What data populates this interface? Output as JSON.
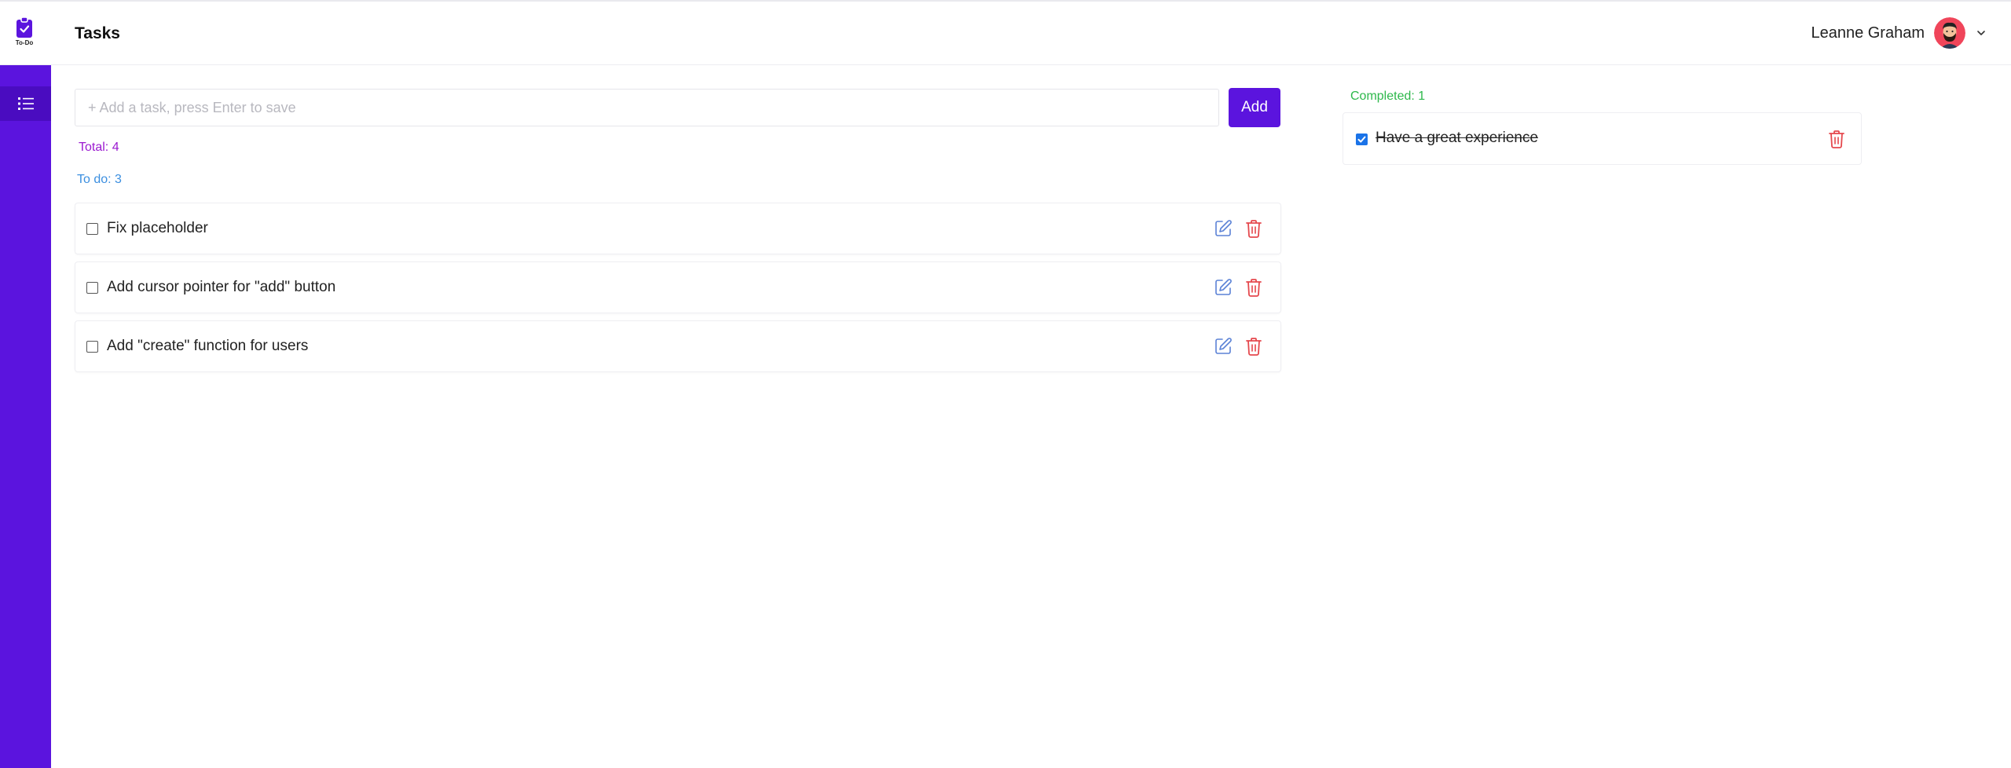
{
  "header": {
    "logo_text": "To-Do",
    "page_title": "Tasks",
    "user_name": "Leanne Graham"
  },
  "sidebar": {
    "items": [
      {
        "name": "tasks",
        "icon": "list-icon",
        "active": true
      }
    ]
  },
  "task_form": {
    "placeholder": "+ Add a task, press Enter to save",
    "value": "",
    "add_label": "Add"
  },
  "counts": {
    "total": "Total: 4",
    "todo": "To do: 3",
    "completed": "Completed: 1"
  },
  "todo_tasks": [
    {
      "text": "Fix placeholder",
      "done": false
    },
    {
      "text": "Add cursor pointer for \"add\" button",
      "done": false
    },
    {
      "text": "Add \"create\" function for users",
      "done": false
    }
  ],
  "completed_tasks": [
    {
      "text": "Have a great experience",
      "done": true
    }
  ],
  "colors": {
    "brand": "#5b14de",
    "brand_dark": "#4a0cc0",
    "total": "#9b1ad0",
    "todo": "#3c8fe0",
    "completed": "#2db84b",
    "delete": "#e5484d",
    "edit": "#5b82d6",
    "checkbox_checked": "#1a73e8"
  }
}
